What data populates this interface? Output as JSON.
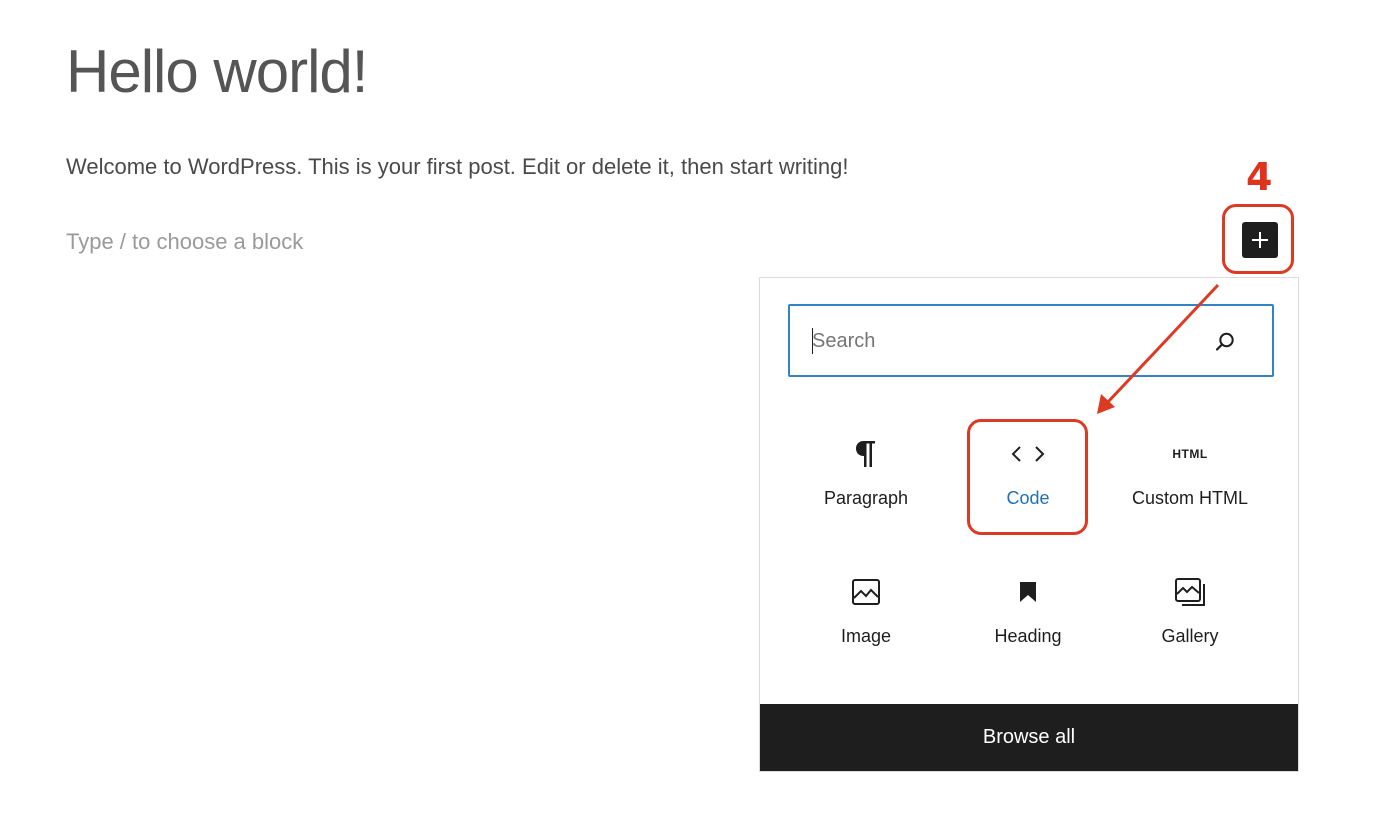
{
  "post": {
    "title": "Hello world!",
    "paragraph": "Welcome to WordPress. This is your first post. Edit or delete it, then start writing!",
    "placeholder": "Type / to choose a block"
  },
  "annotation": {
    "step_number": "4",
    "color": "#dd3a24"
  },
  "inserter": {
    "icon": "plus-icon"
  },
  "popover": {
    "search": {
      "placeholder": "Search",
      "value": "",
      "icon": "search-icon"
    },
    "blocks": [
      {
        "label": "Paragraph",
        "icon": "paragraph-icon"
      },
      {
        "label": "Code",
        "icon": "code-icon",
        "highlighted": true
      },
      {
        "label": "Custom HTML",
        "icon": "html-icon",
        "icon_text": "HTML"
      },
      {
        "label": "Image",
        "icon": "image-icon"
      },
      {
        "label": "Heading",
        "icon": "bookmark-icon"
      },
      {
        "label": "Gallery",
        "icon": "gallery-icon"
      }
    ],
    "browse_all_label": "Browse all"
  },
  "colors": {
    "accent": "#2271b1",
    "search_border": "#3383c7",
    "dark": "#1e1e1e"
  }
}
